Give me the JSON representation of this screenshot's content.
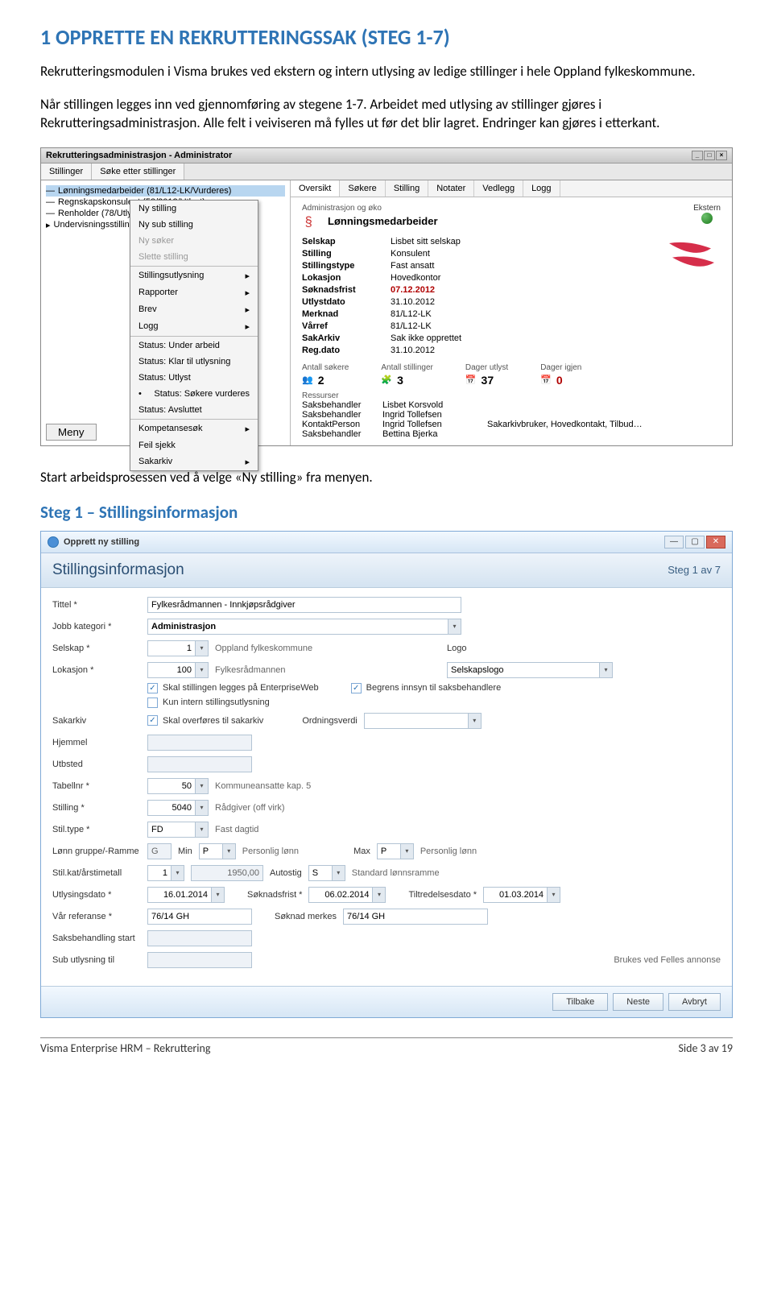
{
  "doc": {
    "h1": "1 OPPRETTE EN REKRUTTERINGSSAK (STEG 1-7)",
    "p1": "Rekrutteringsmodulen i Visma brukes ved ekstern og intern utlysing av ledige stillinger i hele Oppland fylkeskommune.",
    "p2": "Når stillingen legges inn ved gjennomføring av stegene 1-7. Arbeidet med utlysing av stillinger gjøres i Rekrutteringsadministrasjon. Alle felt i veiviseren må fylles ut før det blir lagret. Endringer kan gjøres i etterkant.",
    "p3": "Start arbeidsprosessen ved å velge «Ny stilling» fra menyen.",
    "h2": "Steg 1 – Stillingsinformasjon",
    "footer_left": "Visma Enterprise HRM – Rekruttering",
    "footer_right": "Side 3 av 19"
  },
  "a": {
    "wintitle": "Rekrutteringsadministrasjon - Administrator",
    "tabs_left": [
      "Stillinger",
      "Søke etter stillinger"
    ],
    "tree": [
      {
        "label": "Lønningsmedarbeider (81/L12-LK/Vurderes)",
        "sel": true
      },
      {
        "label": "Regnskapskonsulent (58/2012/Utlyst)"
      },
      {
        "label": "Renholder (78/Utlyst)"
      },
      {
        "label": "Undervisningsstillinger (129/13-LK/Vurderes)",
        "expand": true
      }
    ],
    "ctx": [
      "Ny stilling",
      "Ny sub stilling",
      "Ny søker",
      "Slette stilling",
      "—",
      "Stillingsutlysning",
      "Rapporter",
      "Brev",
      "Logg",
      "—",
      "Status: Under arbeid",
      "Status: Klar til utlysning",
      "Status: Utlyst",
      "Status: Søkere vurderes",
      "Status: Avsluttet",
      "—",
      "Kompetansesøk",
      "Feil sjekk",
      "Sakarkiv"
    ],
    "ctx_disabled": [
      "Ny søker",
      "Slette stilling"
    ],
    "ctx_arrow": [
      "Stillingsutlysning",
      "Rapporter",
      "Brev",
      "Logg",
      "Kompetansesøk",
      "Sakarkiv"
    ],
    "ctx_bullet": "Status: Søkere vurderes",
    "meny": "Meny",
    "tabs_right": [
      "Oversikt",
      "Søkere",
      "Stilling",
      "Notater",
      "Vedlegg",
      "Logg"
    ],
    "ov_sub": "Administrasjon og øko",
    "ov_title": "Lønningsmedarbeider",
    "ov_ekstern": "Ekstern",
    "kv": [
      {
        "k": "Selskap",
        "v": "Lisbet sitt selskap"
      },
      {
        "k": "Stilling",
        "v": "Konsulent"
      },
      {
        "k": "Stillingstype",
        "v": "Fast ansatt"
      },
      {
        "k": "Lokasjon",
        "v": "Hovedkontor"
      },
      {
        "k": "Søknadsfrist",
        "v": "07.12.2012",
        "red": true
      },
      {
        "k": "Utlystdato",
        "v": "31.10.2012"
      },
      {
        "k": "Merknad",
        "v": "81/L12-LK"
      },
      {
        "k": "Vårref",
        "v": "81/L12-LK"
      },
      {
        "k": "SakArkiv",
        "v": "Sak ikke opprettet"
      },
      {
        "k": "Reg.dato",
        "v": "31.10.2012"
      }
    ],
    "stats": [
      {
        "lbl": "Antall søkere",
        "num": "2"
      },
      {
        "lbl": "Antall stillinger",
        "num": "3"
      },
      {
        "lbl": "Dager utlyst",
        "num": "37"
      },
      {
        "lbl": "Dager igjen",
        "num": "0",
        "red": true
      }
    ],
    "ress_label": "Ressurser",
    "ress": [
      {
        "r": "Saksbehandler",
        "n": "Lisbet Korsvold"
      },
      {
        "r": "Saksbehandler",
        "n": "Ingrid Tollefsen"
      },
      {
        "r": "KontaktPerson",
        "n": "Ingrid Tollefsen",
        "extra": "Sakarkivbruker, Hovedkontakt, Tilbud…"
      },
      {
        "r": "Saksbehandler",
        "n": "Bettina Bjerka"
      }
    ]
  },
  "b": {
    "wintitle": "Opprett ny stilling",
    "header": "Stillingsinformasjon",
    "step": "Steg 1 av 7",
    "rows": {
      "tittel_label": "Tittel *",
      "tittel_val": "Fylkesrådmannen - Innkjøpsrådgiver",
      "jobbkat_label": "Jobb kategori *",
      "jobbkat_val": "Administrasjon",
      "selskap_label": "Selskap *",
      "selskap_num": "1",
      "selskap_txt": "Oppland fylkeskommune",
      "logo_label": "Logo",
      "lokasjon_label": "Lokasjon *",
      "lokasjon_num": "100",
      "lokasjon_txt": "Fylkesrådmannen",
      "logo_sel": "Selskapslogo",
      "chk1": "Skal stillingen legges på EnterpriseWeb",
      "chk2": "Begrens innsyn til saksbehandlere",
      "chk3": "Kun intern stillingsutlysning",
      "sakarkiv_label": "Sakarkiv",
      "sakarkiv_chk": "Skal overføres til sakarkiv",
      "ordn_label": "Ordningsverdi",
      "hjemmel_label": "Hjemmel",
      "utbsted_label": "Utbsted",
      "tabellnr_label": "Tabellnr *",
      "tabellnr_num": "50",
      "tabellnr_txt": "Kommuneansatte kap. 5",
      "stilling_label": "Stilling *",
      "stilling_num": "5040",
      "stilling_txt": "Rådgiver (off virk)",
      "stiltype_label": "Stil.type *",
      "stiltype_num": "FD",
      "stiltype_txt": "Fast dagtid",
      "lonn_label": "Lønn gruppe/-Ramme",
      "lonn_g": "G",
      "lonn_min": "Min",
      "lonn_p": "P",
      "lonn_pl": "Personlig lønn",
      "lonn_max": "Max",
      "lonn_p2": "P",
      "lonn_pl2": "Personlig lønn",
      "stilkat_label": "Stil.kat/årstimetall",
      "stilkat_num": "1",
      "stilkat_val": "1950,00",
      "autostig_label": "Autostig",
      "autostig_v": "S",
      "autostig_txt": "Standard lønnsramme",
      "utlys_label": "Utlysingsdato *",
      "utlys_v": "16.01.2014",
      "soknadsfrist_label": "Søknadsfrist *",
      "soknadsfrist_v": "06.02.2014",
      "tiltr_label": "Tiltredelsesdato *",
      "tiltr_v": "01.03.2014",
      "varref_label": "Vår referanse *",
      "varref_v": "76/14 GH",
      "sokm_label": "Søknad merkes",
      "sokm_v": "76/14 GH",
      "saksb_label": "Saksbehandling start",
      "sub_label": "Sub utlysning til",
      "sub_note": "Brukes ved Felles annonse"
    },
    "btns": {
      "tilbake": "Tilbake",
      "neste": "Neste",
      "avbryt": "Avbryt"
    }
  }
}
